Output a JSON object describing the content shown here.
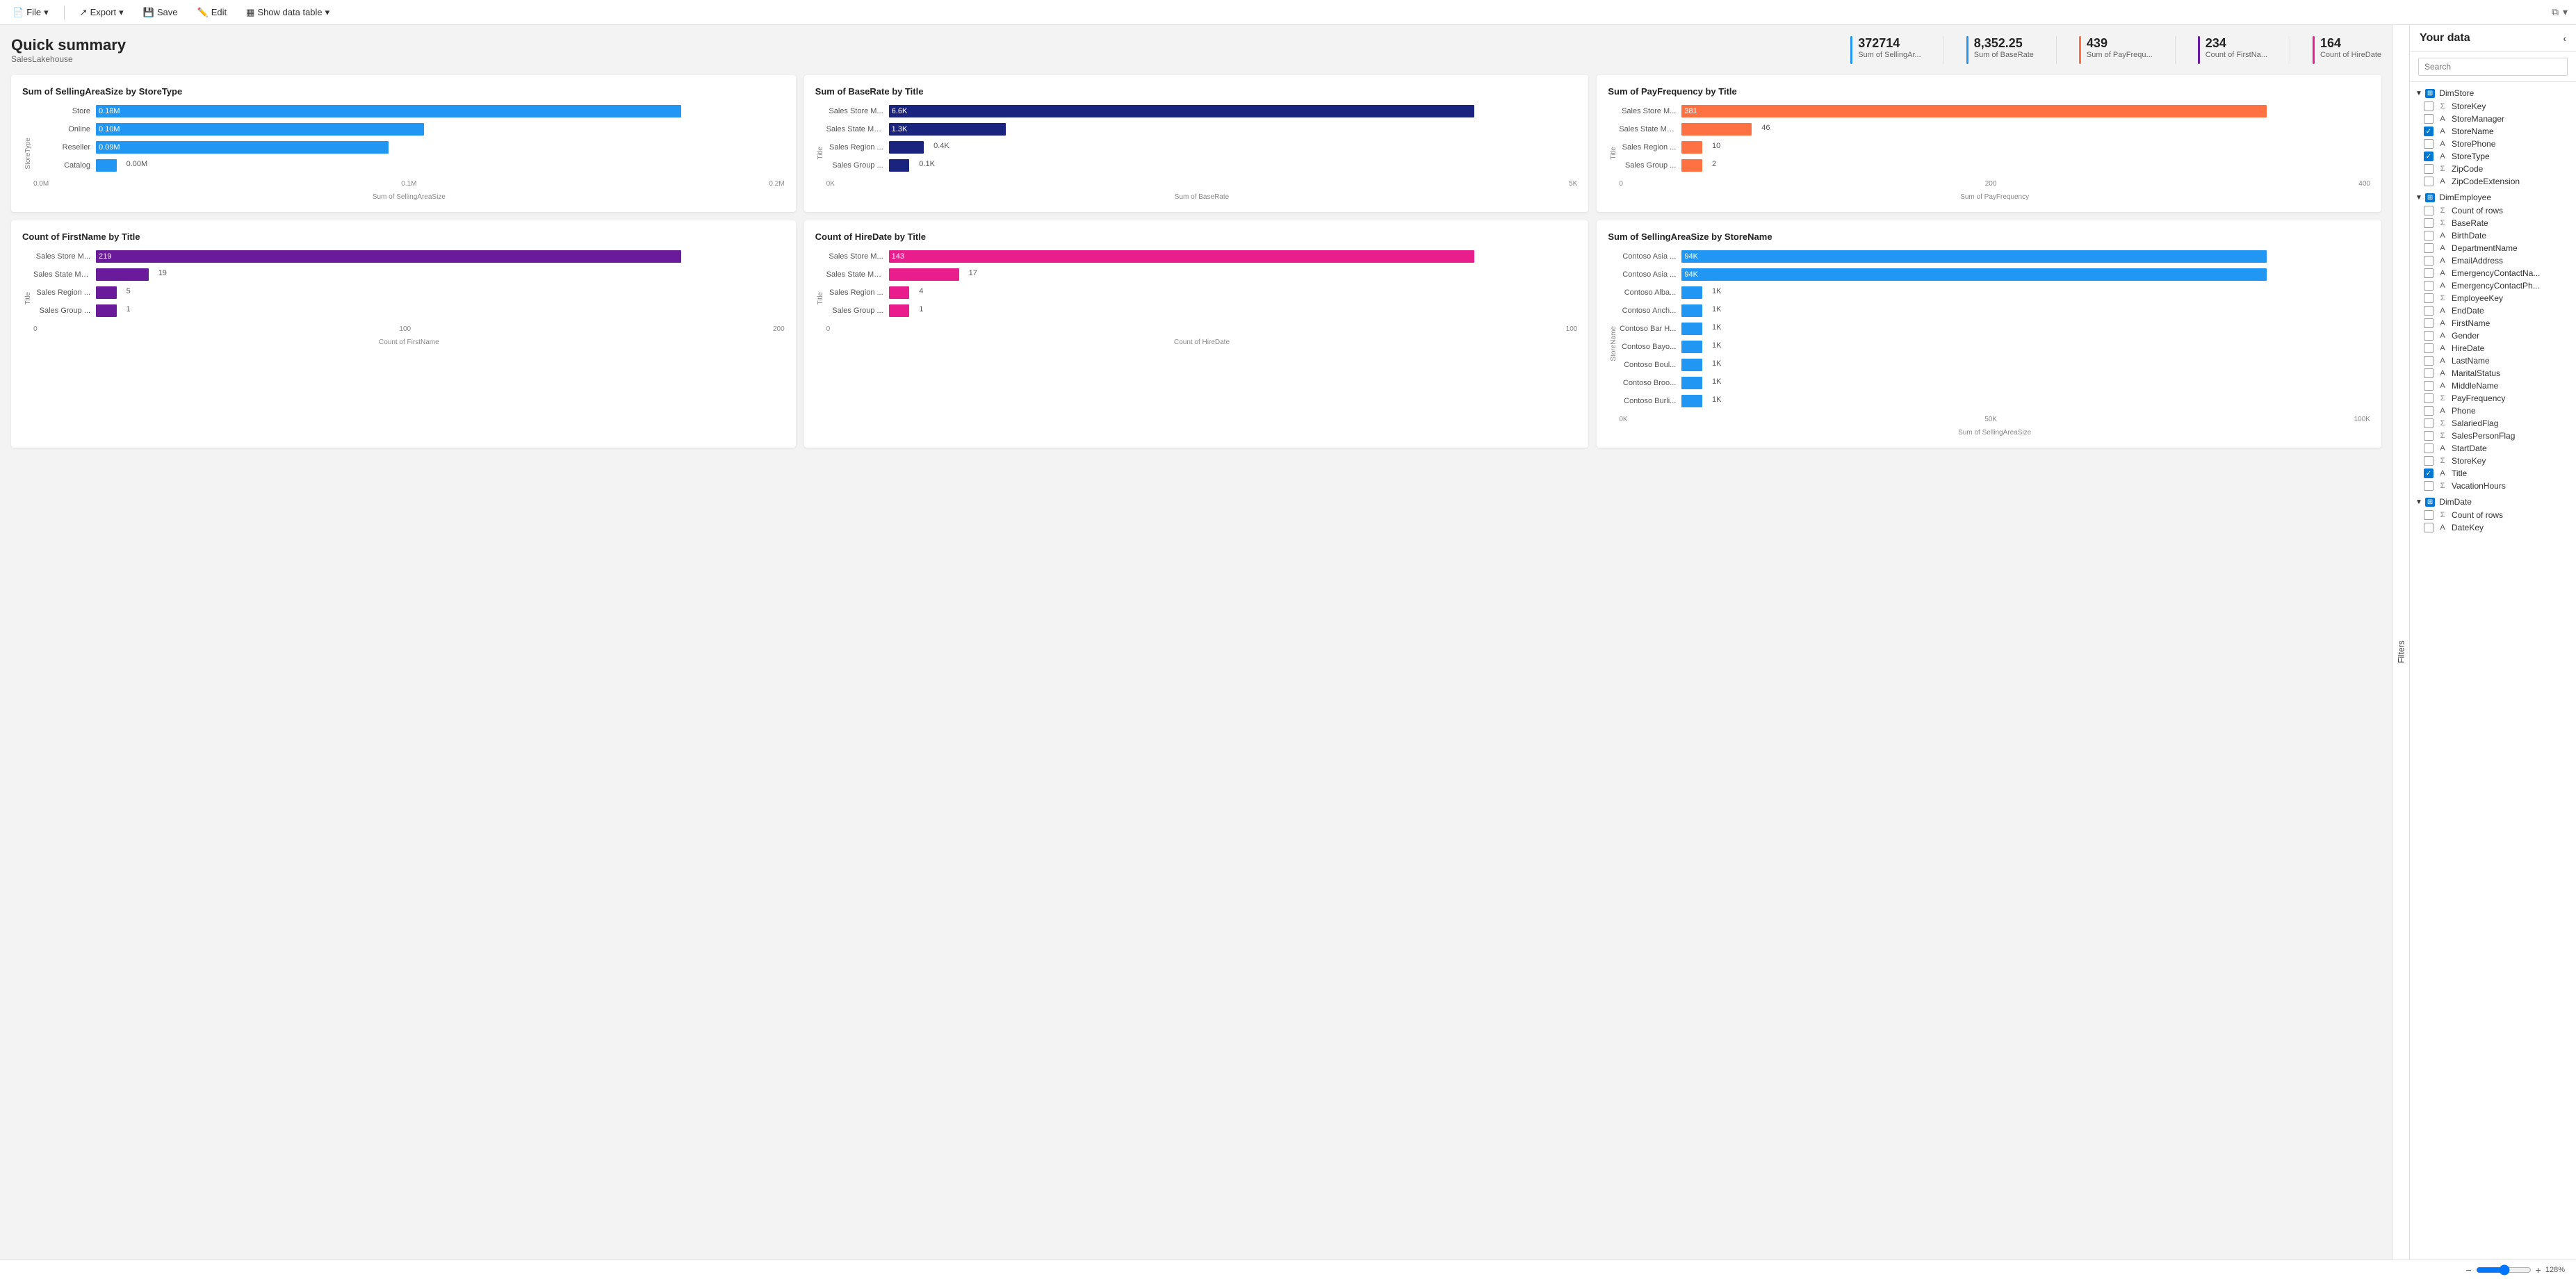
{
  "toolbar": {
    "file_label": "File",
    "export_label": "Export",
    "save_label": "Save",
    "edit_label": "Edit",
    "show_data_table_label": "Show data table"
  },
  "header": {
    "title": "Quick summary",
    "subtitle": "SalesLakehouse"
  },
  "kpis": [
    {
      "value": "372714",
      "label": "Sum of SellingAr...",
      "color": "#2196F3"
    },
    {
      "value": "8,352.25",
      "label": "Sum of BaseRate",
      "color": "#2196F3"
    },
    {
      "value": "439",
      "label": "Sum of PayFrequ...",
      "color": "#FF7043"
    },
    {
      "value": "234",
      "label": "Count of FirstNa...",
      "color": "#6A1B9A"
    },
    {
      "value": "164",
      "label": "Count of HireDate",
      "color": "#E91E8C"
    }
  ],
  "charts": [
    {
      "id": "chart1",
      "title": "Sum of SellingAreaSize by StoreType",
      "y_axis_label": "StoreType",
      "x_axis_label": "Sum of SellingAreaSize",
      "color": "#2196F3",
      "bars": [
        {
          "label": "Store",
          "value": "0.18M",
          "pct": 100
        },
        {
          "label": "Online",
          "value": "0.10M",
          "pct": 56
        },
        {
          "label": "Reseller",
          "value": "0.09M",
          "pct": 50
        },
        {
          "label": "Catalog",
          "value": "0.00M",
          "pct": 3
        }
      ],
      "x_ticks": [
        "0.0M",
        "0.1M",
        "0.2M"
      ]
    },
    {
      "id": "chart2",
      "title": "Sum of BaseRate by Title",
      "y_axis_label": "Title",
      "x_axis_label": "Sum of BaseRate",
      "color": "#1A237E",
      "bars": [
        {
          "label": "Sales Store M...",
          "value": "6.6K",
          "pct": 100
        },
        {
          "label": "Sales State Ma...",
          "value": "1.3K",
          "pct": 20
        },
        {
          "label": "Sales Region ...",
          "value": "0.4K",
          "pct": 6
        },
        {
          "label": "Sales Group ...",
          "value": "0.1K",
          "pct": 2
        }
      ],
      "x_ticks": [
        "0K",
        "5K"
      ]
    },
    {
      "id": "chart3",
      "title": "Sum of PayFrequency by Title",
      "y_axis_label": "Title",
      "x_axis_label": "Sum of PayFrequency",
      "color": "#FF7043",
      "bars": [
        {
          "label": "Sales Store M...",
          "value": "381",
          "pct": 100
        },
        {
          "label": "Sales State Ma...",
          "value": "46",
          "pct": 12
        },
        {
          "label": "Sales Region ...",
          "value": "10",
          "pct": 3
        },
        {
          "label": "Sales Group ...",
          "value": "2",
          "pct": 1
        }
      ],
      "x_ticks": [
        "0",
        "200",
        "400"
      ]
    },
    {
      "id": "chart4",
      "title": "Count of FirstName by Title",
      "y_axis_label": "Title",
      "x_axis_label": "Count of FirstName",
      "color": "#6A1B9A",
      "bars": [
        {
          "label": "Sales Store M...",
          "value": "219",
          "pct": 100
        },
        {
          "label": "Sales State Ma...",
          "value": "19",
          "pct": 9
        },
        {
          "label": "Sales Region ...",
          "value": "5",
          "pct": 2
        },
        {
          "label": "Sales Group ...",
          "value": "1",
          "pct": 0.5
        }
      ],
      "x_ticks": [
        "0",
        "100",
        "200"
      ]
    },
    {
      "id": "chart5",
      "title": "Count of HireDate by Title",
      "y_axis_label": "Title",
      "x_axis_label": "Count of HireDate",
      "color": "#E91E8C",
      "bars": [
        {
          "label": "Sales Store M...",
          "value": "143",
          "pct": 100
        },
        {
          "label": "Sales State Ma...",
          "value": "17",
          "pct": 12
        },
        {
          "label": "Sales Region ...",
          "value": "4",
          "pct": 3
        },
        {
          "label": "Sales Group ...",
          "value": "1",
          "pct": 1
        }
      ],
      "x_ticks": [
        "0",
        "100"
      ]
    },
    {
      "id": "chart6",
      "title": "Sum of SellingAreaSize by StoreName",
      "y_axis_label": "StoreName",
      "x_axis_label": "Sum of SellingAreaSize",
      "color": "#2196F3",
      "bars": [
        {
          "label": "Contoso Asia ...",
          "value": "94K",
          "pct": 100
        },
        {
          "label": "Contoso Asia ...",
          "value": "94K",
          "pct": 100
        },
        {
          "label": "Contoso Alba...",
          "value": "1K",
          "pct": 2
        },
        {
          "label": "Contoso Anch...",
          "value": "1K",
          "pct": 2
        },
        {
          "label": "Contoso Bar H...",
          "value": "1K",
          "pct": 2
        },
        {
          "label": "Contoso Bayo...",
          "value": "1K",
          "pct": 2
        },
        {
          "label": "Contoso Boul...",
          "value": "1K",
          "pct": 2
        },
        {
          "label": "Contoso Broo...",
          "value": "1K",
          "pct": 2
        },
        {
          "label": "Contoso Burli...",
          "value": "1K",
          "pct": 2
        }
      ],
      "x_ticks": [
        "0K",
        "50K",
        "100K"
      ]
    }
  ],
  "sidebar": {
    "title": "Your data",
    "search_placeholder": "Search",
    "filters_label": "Filters",
    "sections": [
      {
        "name": "DimStore",
        "collapsed": false,
        "items": [
          {
            "label": "StoreKey",
            "type": "sigma",
            "checked": false
          },
          {
            "label": "StoreManager",
            "type": "text",
            "checked": false
          },
          {
            "label": "StoreName",
            "type": "text",
            "checked": true
          },
          {
            "label": "StorePhone",
            "type": "text",
            "checked": false
          },
          {
            "label": "StoreType",
            "type": "text",
            "checked": true
          },
          {
            "label": "ZipCode",
            "type": "sigma",
            "checked": false
          },
          {
            "label": "ZipCodeExtension",
            "type": "text",
            "checked": false
          }
        ]
      },
      {
        "name": "DimEmployee",
        "collapsed": false,
        "items": [
          {
            "label": "Count of rows",
            "type": "sigma",
            "checked": false
          },
          {
            "label": "BaseRate",
            "type": "sigma",
            "checked": false
          },
          {
            "label": "BirthDate",
            "type": "text",
            "checked": false
          },
          {
            "label": "DepartmentName",
            "type": "text",
            "checked": false
          },
          {
            "label": "EmailAddress",
            "type": "text",
            "checked": false
          },
          {
            "label": "EmergencyContactNa...",
            "type": "text",
            "checked": false
          },
          {
            "label": "EmergencyContactPh...",
            "type": "text",
            "checked": false
          },
          {
            "label": "EmployeeKey",
            "type": "sigma",
            "checked": false
          },
          {
            "label": "EndDate",
            "type": "text",
            "checked": false
          },
          {
            "label": "FirstName",
            "type": "text",
            "checked": false
          },
          {
            "label": "Gender",
            "type": "text",
            "checked": false
          },
          {
            "label": "HireDate",
            "type": "text",
            "checked": false
          },
          {
            "label": "LastName",
            "type": "text",
            "checked": false
          },
          {
            "label": "MaritalStatus",
            "type": "text",
            "checked": false
          },
          {
            "label": "MiddleName",
            "type": "text",
            "checked": false
          },
          {
            "label": "PayFrequency",
            "type": "sigma",
            "checked": false
          },
          {
            "label": "Phone",
            "type": "text",
            "checked": false
          },
          {
            "label": "SalariedFlag",
            "type": "sigma",
            "checked": false
          },
          {
            "label": "SalesPersonFlag",
            "type": "sigma",
            "checked": false
          },
          {
            "label": "StartDate",
            "type": "text",
            "checked": false
          },
          {
            "label": "StoreKey",
            "type": "sigma",
            "checked": false
          },
          {
            "label": "Title",
            "type": "text",
            "checked": true
          },
          {
            "label": "VacationHours",
            "type": "sigma",
            "checked": false
          }
        ]
      },
      {
        "name": "DimDate",
        "collapsed": false,
        "items": [
          {
            "label": "Count of rows",
            "type": "sigma",
            "checked": false
          },
          {
            "label": "DateKey",
            "type": "text",
            "checked": false
          }
        ]
      }
    ]
  },
  "bottom_bar": {
    "zoom_level": "128%",
    "zoom_minus": "−",
    "zoom_plus": "+"
  }
}
